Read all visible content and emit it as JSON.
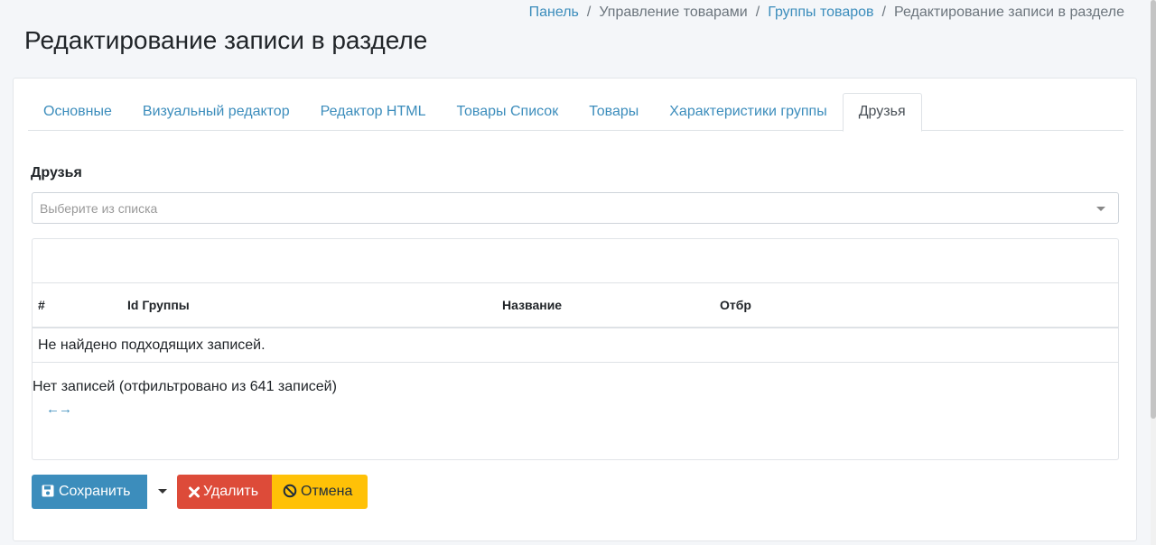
{
  "breadcrumb": {
    "items": [
      "Панель",
      "Управление товарами",
      "Группы товаров"
    ],
    "current": "Редактирование записи в разделе",
    "separator": "/"
  },
  "page": {
    "title": "Редактирование записи в разделе"
  },
  "tabs": [
    {
      "label": "Основные"
    },
    {
      "label": "Визуальный редактор"
    },
    {
      "label": "Редактор HTML"
    },
    {
      "label": "Товары Список"
    },
    {
      "label": "Товары"
    },
    {
      "label": "Характеристики группы"
    },
    {
      "label": "Друзья",
      "active": true
    }
  ],
  "form": {
    "friends_label": "Друзья",
    "friends_select": {
      "placeholder": "Выберите из списка",
      "value": ""
    }
  },
  "grid": {
    "columns": [
      "#",
      "Id Группы",
      "Название",
      "Отбр"
    ],
    "empty_text": "Не найдено подходящих записей.",
    "summary": "Нет записей (отфильтровано из 641 записей)",
    "pager_arrows": "←→"
  },
  "actions": {
    "save_label": "Сохранить",
    "delete_label": "Удалить",
    "cancel_label": "Отмена"
  },
  "colors": {
    "primary": "#3c8dbc",
    "danger": "#dd4b39",
    "warning": "#ffc107",
    "background": "#f4f6f9"
  }
}
